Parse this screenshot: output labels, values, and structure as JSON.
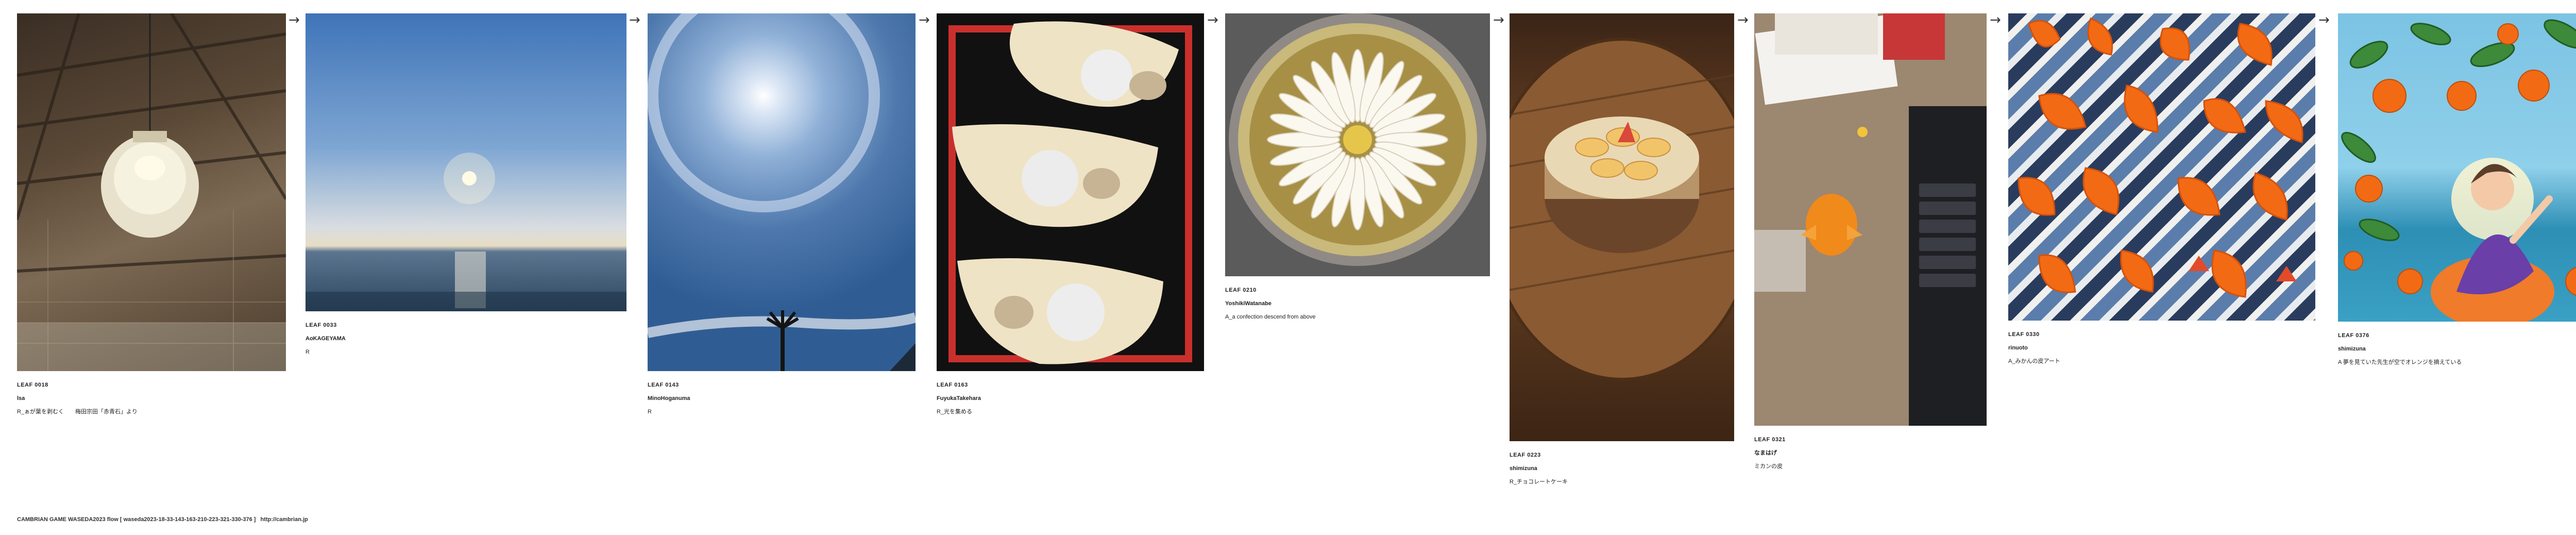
{
  "cards": [
    {
      "id": "LEAF 0018",
      "author": "lsa",
      "title": "R_ぁが葉を剥むく　　梅田宗田「赤青石」より",
      "image": "barn-interior-lamp"
    },
    {
      "id": "LEAF 0033",
      "author": "AoKAGEYAMA",
      "title": "R",
      "image": "sunset-over-sea"
    },
    {
      "id": "LEAF 0143",
      "author": "MinoHoganuma",
      "title": "R",
      "image": "sun-halo-sky"
    },
    {
      "id": "LEAF 0163",
      "author": "FuyukaTakehara",
      "title": "R_光を集める",
      "image": "daifuku-on-leaf-boats"
    },
    {
      "id": "LEAF 0210",
      "author": "YoshikiWatanabe",
      "title": "A_a confection descend from above",
      "image": "tart-overhead"
    },
    {
      "id": "LEAF 0223",
      "author": "shimizuna",
      "title": "R_チョコレートケーキ",
      "image": "cake-on-wooden-table"
    },
    {
      "id": "LEAF 0321",
      "author": "なまはげ",
      "title": "ミカンの皮",
      "image": "peeled-orange-on-desk"
    },
    {
      "id": "LEAF 0330",
      "author": "rinuoto",
      "title": "A_みかんの皮アート",
      "image": "orange-peel-art"
    },
    {
      "id": "LEAF 0376",
      "author": "shimizuna",
      "title": "A 夢を見ていた先生が空でオレンジを摘えている",
      "image": "orange-tree-painting"
    }
  ],
  "arrow_glyph": "→",
  "footer": {
    "brand": "CAMBRIAN GAME  WASEDA2023  flow [ waseda2023-18-33-143-163-210-223-321-330-376 ]",
    "url": "http://cambrian.jp"
  },
  "colors": {
    "orange": "#f36a14",
    "sky": "#4a6f9e",
    "wood": "#6a4326"
  }
}
